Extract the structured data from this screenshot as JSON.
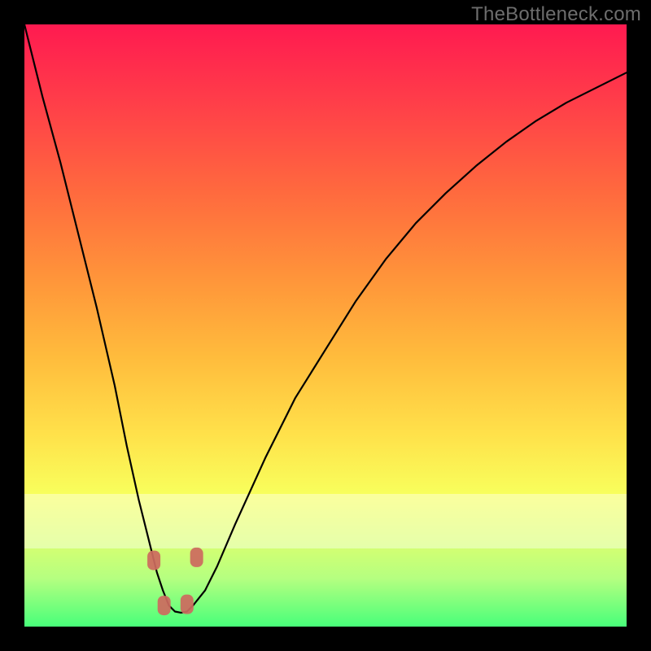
{
  "watermark": "TheBottleneck.com",
  "colors": {
    "frame": "#000000",
    "gradient_top": "#ff1a50",
    "gradient_bottom": "#48ff7a",
    "curve": "#000000",
    "marker": "#cc6a5f"
  },
  "chart_data": {
    "type": "line",
    "title": "",
    "xlabel": "",
    "ylabel": "",
    "xlim": [
      0,
      100
    ],
    "ylim": [
      0,
      100
    ],
    "x": [
      0,
      3,
      6,
      9,
      12,
      15,
      17,
      19,
      21,
      22,
      23,
      24,
      25,
      26,
      27,
      28,
      30,
      32,
      35,
      40,
      45,
      50,
      55,
      60,
      65,
      70,
      75,
      80,
      85,
      90,
      95,
      100
    ],
    "y": [
      100,
      88,
      77,
      65,
      53,
      40,
      30,
      21,
      13,
      9,
      6,
      3.5,
      2.5,
      2.3,
      2.5,
      3.5,
      6,
      10,
      17,
      28,
      38,
      46,
      54,
      61,
      67,
      72,
      76.5,
      80.5,
      84,
      87,
      89.5,
      92
    ],
    "markers": [
      {
        "x": 21.5,
        "y": 11
      },
      {
        "x": 28.6,
        "y": 11.5
      },
      {
        "x": 23.2,
        "y": 3.5
      },
      {
        "x": 27.0,
        "y": 3.7
      }
    ],
    "note": "Values are read from pixel geometry; the figure has no numeric axes so x,y are normalized 0-100 with y=0 at bottom and y=100 at top of the gradient area."
  }
}
